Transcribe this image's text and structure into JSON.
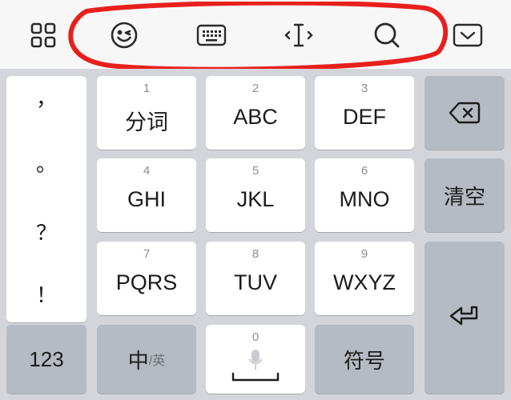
{
  "toolbar": {
    "icons": [
      "apps-grid-icon",
      "emoji-icon",
      "keyboard-icon",
      "cursor-icon",
      "search-icon",
      "hide-keyboard-icon"
    ]
  },
  "punctuation": {
    "items": [
      "，",
      "。",
      "？",
      "！"
    ]
  },
  "keys": {
    "k1": {
      "num": "1",
      "label": "分词"
    },
    "k2": {
      "num": "2",
      "label": "ABC"
    },
    "k3": {
      "num": "3",
      "label": "DEF"
    },
    "k4": {
      "num": "4",
      "label": "GHI"
    },
    "k5": {
      "num": "5",
      "label": "JKL"
    },
    "k6": {
      "num": "6",
      "label": "MNO"
    },
    "k7": {
      "num": "7",
      "label": "PQRS"
    },
    "k8": {
      "num": "8",
      "label": "TUV"
    },
    "k9": {
      "num": "9",
      "label": "WXYZ"
    },
    "k0": {
      "num": "0"
    }
  },
  "right": {
    "clear_label": "清空"
  },
  "bottom": {
    "numbers_label": "123",
    "lang_main": "中",
    "lang_sub": "/英",
    "symbols_label": "符号"
  },
  "colors": {
    "annotation": "#e8201c",
    "key_white": "#ffffff",
    "key_gray": "#b5bac3",
    "keyboard_bg": "#d3d5da"
  }
}
